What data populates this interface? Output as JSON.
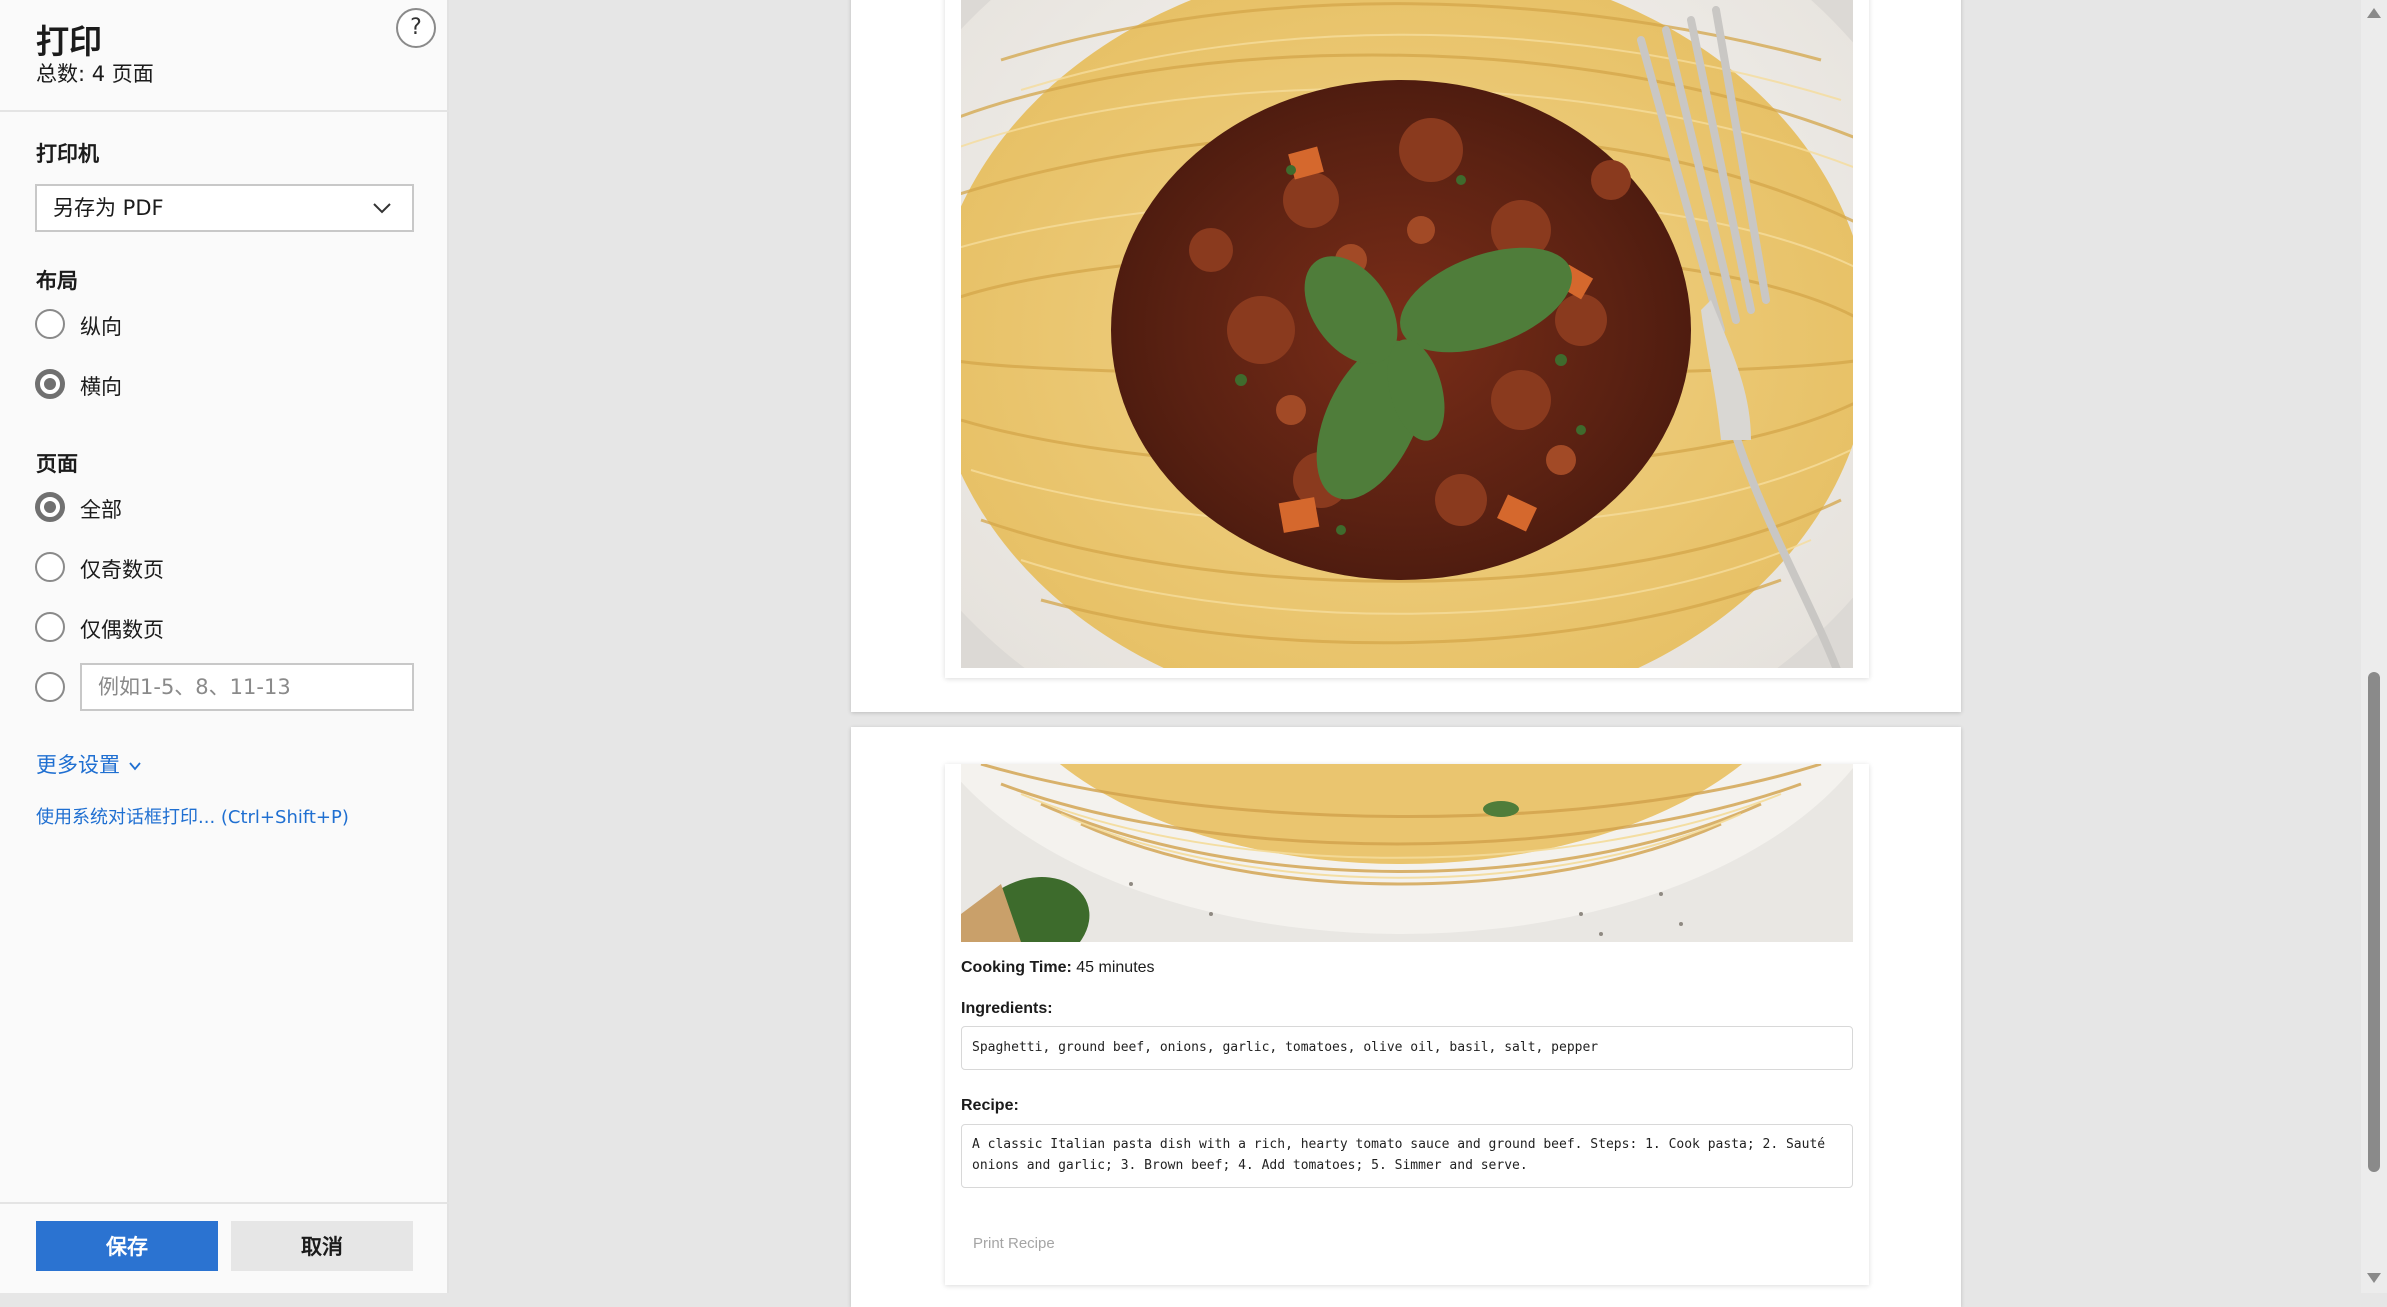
{
  "panel": {
    "title": "打印",
    "total_pages": "总数: 4 页面",
    "help_label": "?",
    "printer": {
      "heading": "打印机",
      "selected": "另存为 PDF"
    },
    "layout": {
      "heading": "布局",
      "options": [
        {
          "label": "纵向",
          "selected": false
        },
        {
          "label": "横向",
          "selected": true
        }
      ]
    },
    "pages": {
      "heading": "页面",
      "options": [
        {
          "label": "全部",
          "selected": true
        },
        {
          "label": "仅奇数页",
          "selected": false
        },
        {
          "label": "仅偶数页",
          "selected": false
        }
      ],
      "custom_range_placeholder": "例如1-5、8、11-13"
    },
    "more_settings": "更多设置",
    "system_dialog": "使用系统对话框打印... (Ctrl+Shift+P)",
    "save_label": "保存",
    "cancel_label": "取消",
    "accent_color": "#2b73d1"
  },
  "preview": {
    "recipe": {
      "cooking_time_label": "Cooking Time:",
      "cooking_time_value": " 45 minutes",
      "ingredients_heading": "Ingredients:",
      "ingredients": "Spaghetti, ground beef, onions, garlic, tomatoes, olive oil, basil, salt, pepper",
      "recipe_heading": "Recipe:",
      "recipe_text": "A classic Italian pasta dish with a rich, hearty tomato sauce and ground beef. Steps: 1. Cook pasta; 2. Sauté onions and garlic; 3. Brown beef; 4. Add tomatoes; 5. Simmer and serve.",
      "print_button": "Print Recipe"
    }
  }
}
